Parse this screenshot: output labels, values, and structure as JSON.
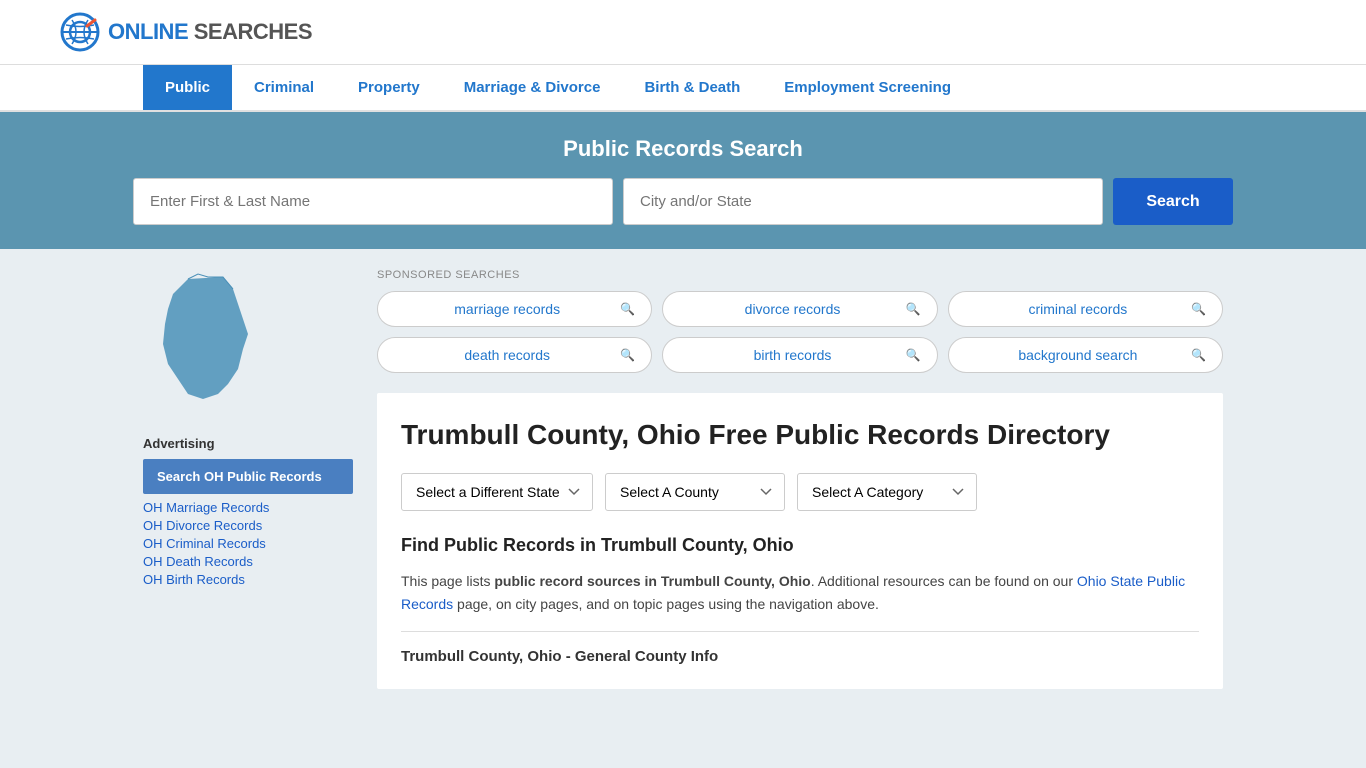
{
  "logo": {
    "text_online": "ONLINE",
    "text_searches": "SEARCHES"
  },
  "nav": {
    "items": [
      {
        "label": "Public",
        "active": true
      },
      {
        "label": "Criminal",
        "active": false
      },
      {
        "label": "Property",
        "active": false
      },
      {
        "label": "Marriage & Divorce",
        "active": false
      },
      {
        "label": "Birth & Death",
        "active": false
      },
      {
        "label": "Employment Screening",
        "active": false
      }
    ]
  },
  "search_banner": {
    "title": "Public Records Search",
    "name_placeholder": "Enter First & Last Name",
    "location_placeholder": "City and/or State",
    "button_label": "Search"
  },
  "sponsored": {
    "label": "SPONSORED SEARCHES",
    "items": [
      "marriage records",
      "divorce records",
      "criminal records",
      "death records",
      "birth records",
      "background search"
    ]
  },
  "sidebar": {
    "advertising_label": "Advertising",
    "ad_box_text": "Search OH Public Records",
    "links": [
      "OH Marriage Records",
      "OH Divorce Records",
      "OH Criminal Records",
      "OH Death Records",
      "OH Birth Records"
    ]
  },
  "content": {
    "page_title": "Trumbull County, Ohio Free Public Records Directory",
    "dropdowns": {
      "state_label": "Select a Different State",
      "county_label": "Select A County",
      "category_label": "Select A Category"
    },
    "find_records_title": "Find Public Records in Trumbull County, Ohio",
    "description": "This page lists ",
    "description_bold": "public record sources in Trumbull County, Ohio",
    "description_end": ". Additional resources can be found on our ",
    "description_link": "Ohio State Public Records",
    "description_after": " page, on city pages, and on topic pages using the navigation above.",
    "general_info": "Trumbull County, Ohio - General County Info"
  }
}
